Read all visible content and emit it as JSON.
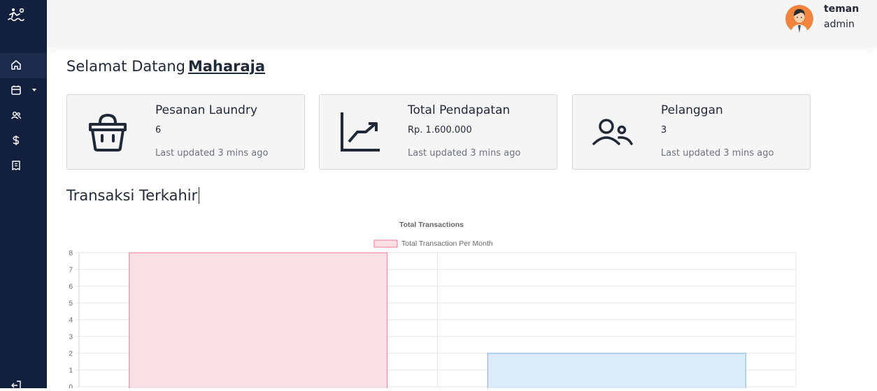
{
  "sidebar": {
    "items": [
      {
        "icon": "home-icon",
        "active": true
      },
      {
        "icon": "calendar-icon",
        "has_dropdown": true
      },
      {
        "icon": "users-icon"
      },
      {
        "icon": "dollar-icon"
      },
      {
        "icon": "receipt-icon"
      },
      {
        "icon": "logout-icon"
      }
    ]
  },
  "header": {
    "user_name": "teman",
    "user_role": "admin"
  },
  "welcome": {
    "greeting": "Selamat Datang",
    "name": "Maharaja"
  },
  "cards": [
    {
      "icon": "basket-icon",
      "title": "Pesanan Laundry",
      "value": "6",
      "updated": "Last updated 3 mins ago"
    },
    {
      "icon": "trending-up-icon",
      "title": "Total Pendapatan",
      "value": "Rp. 1.600.000",
      "updated": "Last updated 3 mins ago"
    },
    {
      "icon": "users-icon",
      "title": "Pelanggan",
      "value": "3",
      "updated": "Last updated 3 mins ago"
    }
  ],
  "section": {
    "title": "Transaksi Terkahir"
  },
  "chart_data": {
    "type": "bar",
    "title": "Total Transactions",
    "series": [
      {
        "name": "Total Transaction Per Month",
        "values": [
          8,
          2
        ]
      }
    ],
    "bar_colors": [
      "#fae0e5",
      "#dcebfa"
    ],
    "bar_border_colors": [
      "#f07b92",
      "#76b6e8"
    ],
    "ylim": [
      0,
      8
    ],
    "yticks": [
      "8",
      "7",
      "6",
      "5",
      "4",
      "3",
      "2",
      "1",
      "0"
    ],
    "grid": true,
    "legend_position": "top"
  },
  "colors": {
    "sidebar_bg": "#12203d",
    "topbar_bg": "#f5f5f5",
    "card_bg": "#f5f5f5"
  }
}
